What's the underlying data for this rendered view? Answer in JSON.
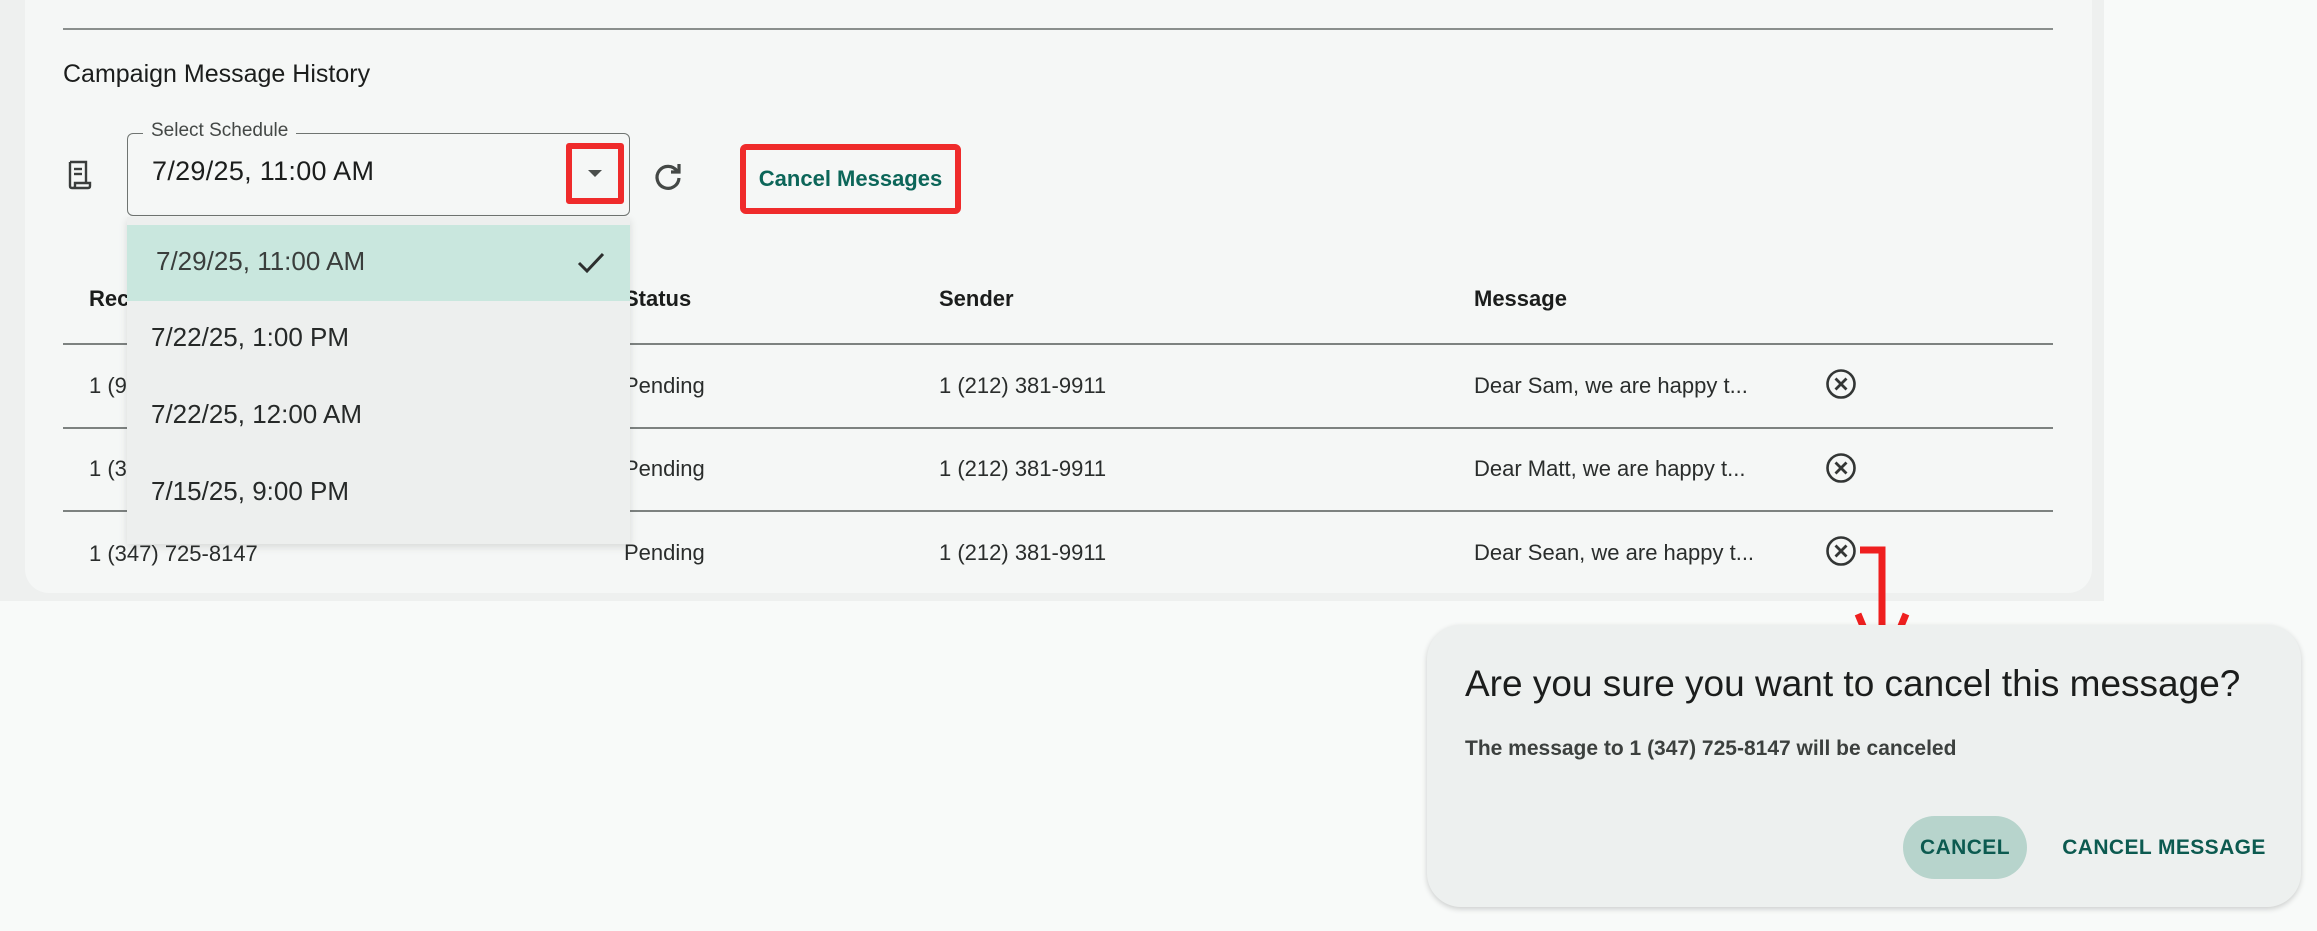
{
  "section": {
    "title": "Campaign Message History"
  },
  "schedule": {
    "label": "Select Schedule",
    "value": "7/29/25, 11:00 AM",
    "options": [
      "7/29/25, 11:00 AM",
      "7/22/25, 1:00 PM",
      "7/22/25, 12:00 AM",
      "7/15/25, 9:00 PM"
    ],
    "selected_index": 0
  },
  "toolbar": {
    "cancel_messages_label": "Cancel Messages"
  },
  "table": {
    "columns": [
      "Rec",
      "Status",
      "Sender",
      "Message"
    ],
    "rows": [
      {
        "recipient": "1 (9",
        "status": "Pending",
        "sender": "1 (212) 381-9911",
        "message": "Dear Sam, we are happy t..."
      },
      {
        "recipient": "1 (3",
        "status": "Pending",
        "sender": "1 (212) 381-9911",
        "message": "Dear Matt, we are happy t..."
      },
      {
        "recipient": "1 (347) 725-8147",
        "status": "Pending",
        "sender": "1 (212) 381-9911",
        "message": "Dear Sean, we are happy t..."
      }
    ]
  },
  "dialog": {
    "title": "Are you sure you want to cancel this message?",
    "body": "The message to 1 (347) 725-8147 will be canceled",
    "cancel_label": "CANCEL",
    "confirm_label": "CANCEL MESSAGE"
  },
  "colors": {
    "accent": "#0c6659",
    "highlight_red": "#ef2b2b",
    "selected_option_bg": "#c9e7de"
  }
}
